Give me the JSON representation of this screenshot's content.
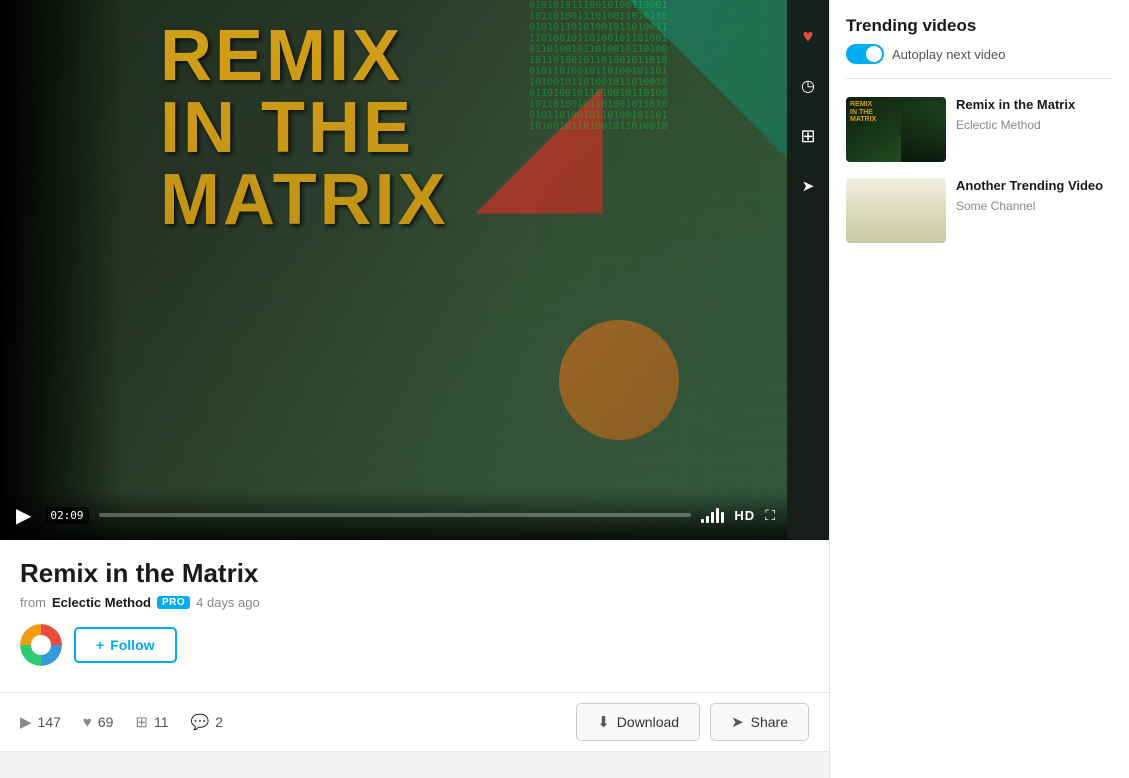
{
  "video": {
    "title": "Remix in the Matrix",
    "from_label": "from",
    "channel_name": "Eclectic Method",
    "pro_badge": "PRO",
    "time_ago": "4 days ago",
    "duration": "02:09",
    "hd_label": "HD"
  },
  "follow_button": {
    "label": "Follow",
    "plus": "+"
  },
  "stats": {
    "plays": "147",
    "likes": "69",
    "collections": "11",
    "comments": "2"
  },
  "actions": {
    "download_label": "Download",
    "share_label": "Share"
  },
  "sidebar": {
    "trending_title": "Trending videos",
    "autoplay_label": "Autoplay next video",
    "trending_video_1": {
      "title": "Remix in the Matrix",
      "channel": "Eclectic Method"
    },
    "trending_video_2": {
      "title": "Another Trending Video",
      "channel": "Some Channel"
    }
  },
  "sidebar_icons": {
    "heart": "♥",
    "clock": "🕐",
    "layers": "⊞",
    "share": "✈"
  },
  "volume_bars": [
    4,
    7,
    11,
    15,
    11
  ],
  "colors": {
    "accent": "#00adef",
    "pro_bg": "#00adef",
    "title_yellow": "#d4a017"
  }
}
